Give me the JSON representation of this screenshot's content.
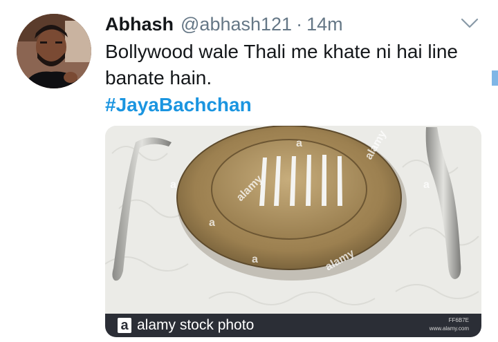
{
  "tweet": {
    "author_name": "Abhash",
    "author_handle": "@abhash121",
    "separator": "·",
    "timestamp": "14m",
    "text": "Bollywood wale Thali me khate ni hai line banate hain.",
    "hashtag": "#JayaBachchan"
  },
  "icons": {
    "menu": "chevron-down-icon",
    "stock": "alamy-logo-icon"
  },
  "media": {
    "stock_logo_letter": "a",
    "stock_caption": "alamy stock photo",
    "image_id": "FF6B7E",
    "image_site": "www.alamy.com",
    "watermarks": [
      "alamy",
      "alamy",
      "alamy",
      "a",
      "a",
      "a",
      "a",
      "a"
    ]
  },
  "colors": {
    "text": "#14171a",
    "secondary": "#657786",
    "link": "#1b95e0",
    "stock_bar": "#2b2e36"
  }
}
